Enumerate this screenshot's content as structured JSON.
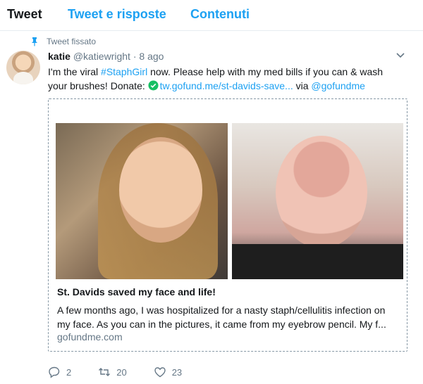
{
  "tabs": [
    {
      "label": "Tweet"
    },
    {
      "label": "Tweet e risposte"
    },
    {
      "label": "Contenuti"
    }
  ],
  "pinned_label": "Tweet fissato",
  "tweet": {
    "name": "katie",
    "handle": "@katiewright",
    "separator": "·",
    "time": "8 ago",
    "text_part1": "I'm the viral ",
    "hashtag": "#StaphGirl",
    "text_part2": " now. Please help with my med bills if you can & wash your brushes! Donate: ",
    "link_text": "tw.gofund.me/st-davids-save...",
    "text_part3": " via ",
    "mention": "@gofundme"
  },
  "card": {
    "title": "St. Davids saved my face and life!",
    "description": "A few months ago, I was hospitalized for a nasty staph/cellulitis infection on my face. As you can in the pictures, it came from my eyebrow pencil. My f...",
    "domain": "gofundme.com"
  },
  "actions": {
    "replies": "2",
    "retweets": "20",
    "likes": "23"
  },
  "colors": {
    "accent": "#1da1f2",
    "muted": "#657786",
    "check": "#17bf63"
  }
}
